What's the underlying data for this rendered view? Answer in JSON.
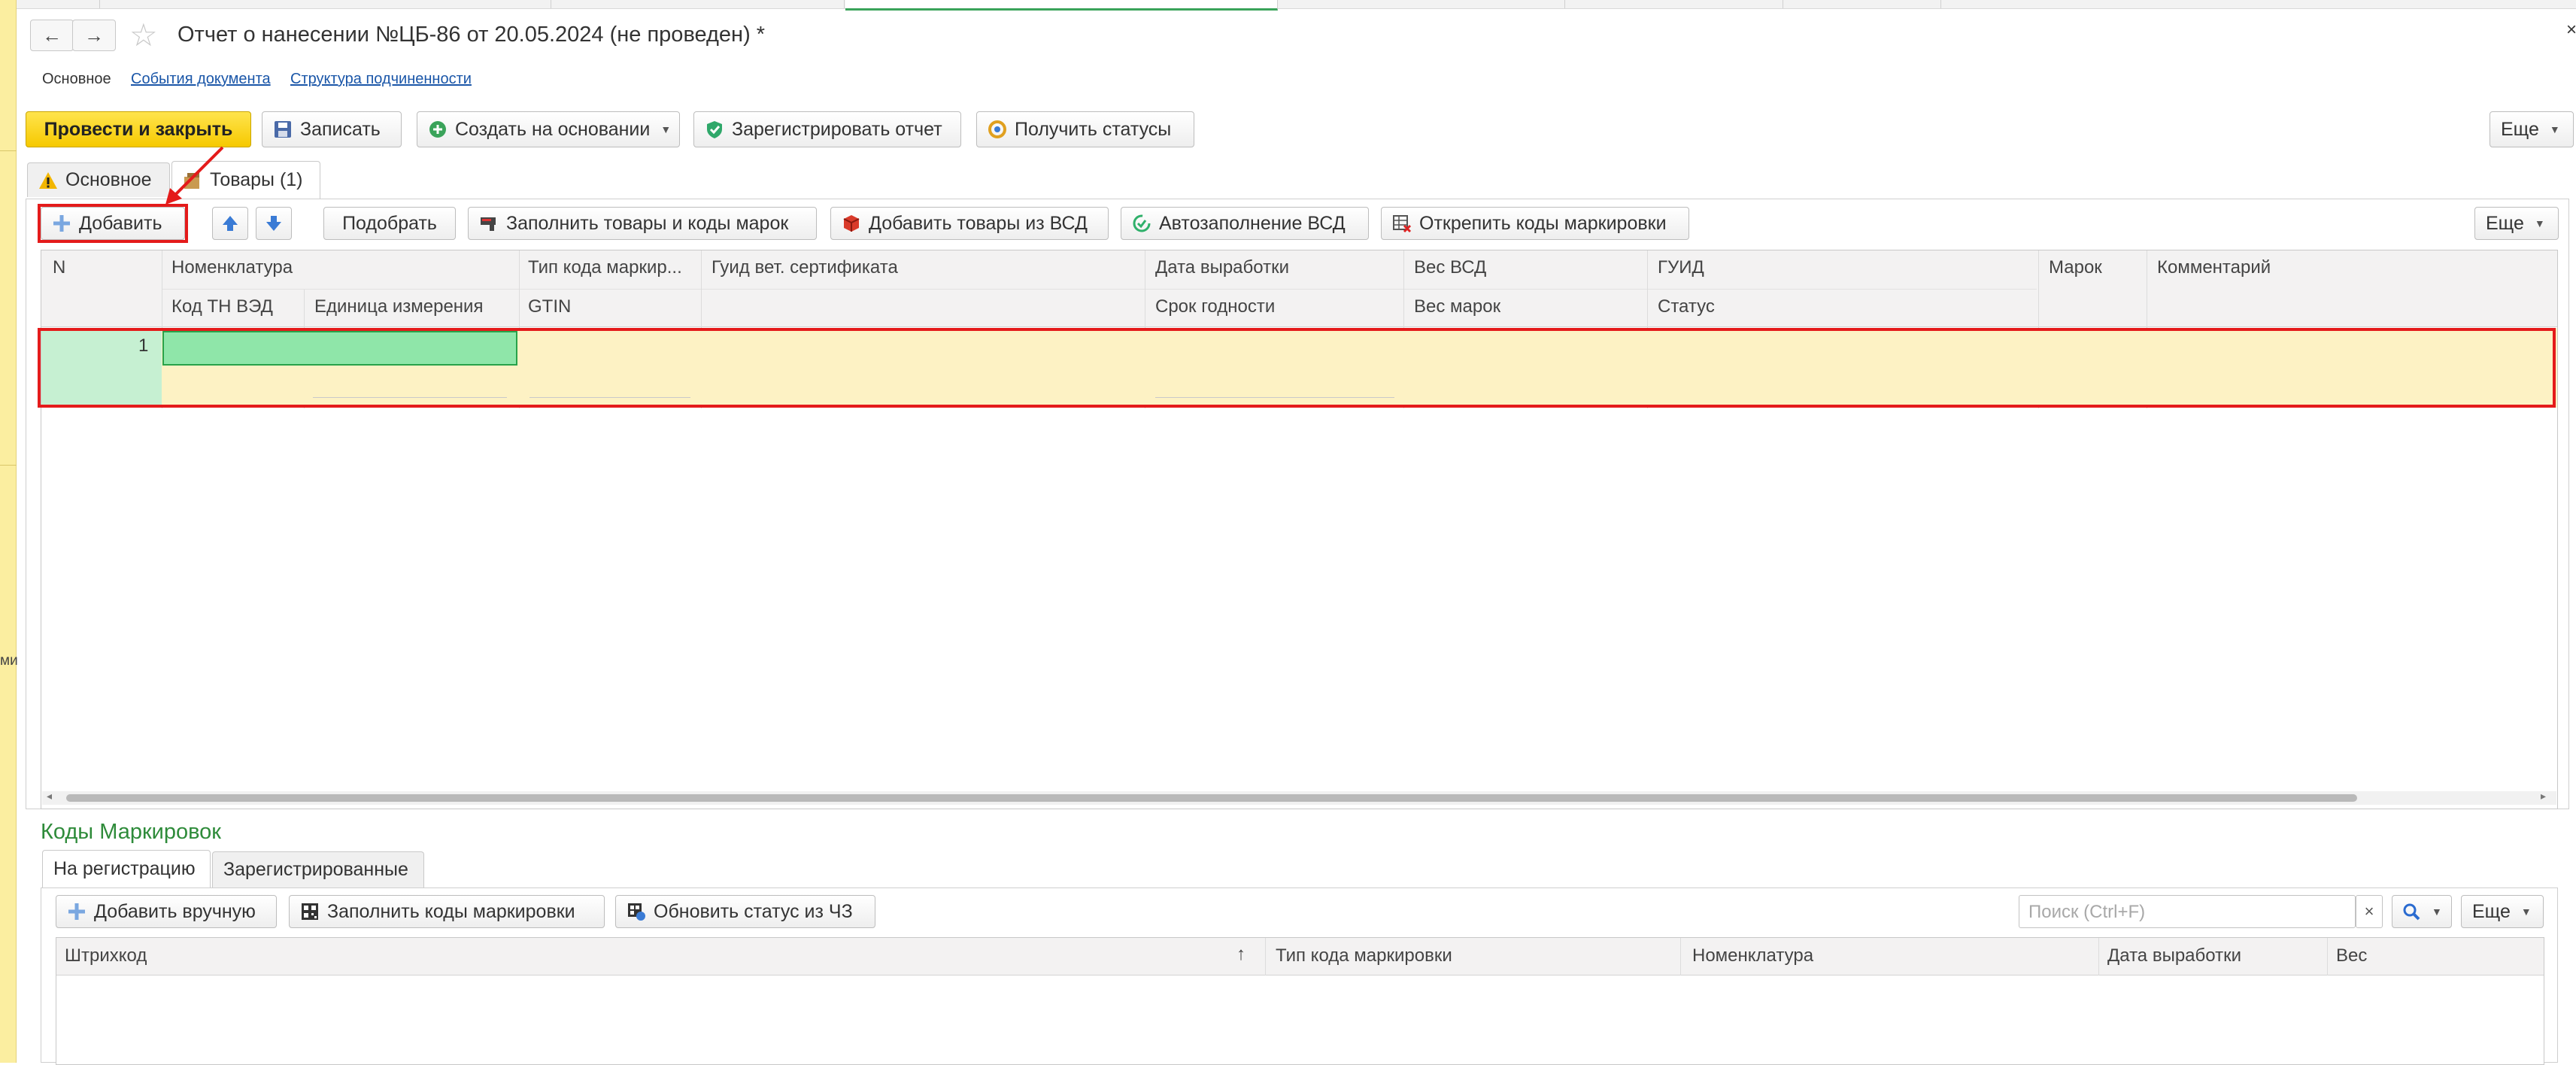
{
  "left_strip": {
    "text": "ми"
  },
  "header": {
    "title": "Отчет о нанесении №ЦБ-86 от 20.05.2024 (не проведен) *",
    "subnav": [
      "Основное",
      "События документа",
      "Структура подчиненности"
    ]
  },
  "toolbar": {
    "post_close": "Провести и закрыть",
    "save": "Записать",
    "create_based": "Создать на основании",
    "register_report": "Зарегистрировать отчет",
    "get_statuses": "Получить статусы",
    "more": "Еще"
  },
  "tabs": [
    {
      "label": "Основное",
      "icon": "warning-icon"
    },
    {
      "label": "Товары (1)",
      "icon": "goods-icon"
    }
  ],
  "goods_toolbar": {
    "add": "Добавить",
    "pick": "Подобрать",
    "fill_goods_codes": "Заполнить товары и коды марок",
    "add_from_vsd": "Добавить товары из ВСД",
    "autofill_vsd": "Автозаполнение ВСД",
    "unpin_codes": "Открепить коды маркировки",
    "more": "Еще"
  },
  "goods_table": {
    "columns_row1": [
      "N",
      "Номенклатура",
      "Тип кода маркир...",
      "Гуид вет. сертификата",
      "Дата выработки",
      "Вес ВСД",
      "ГУИД",
      "Марок",
      "Комментарий"
    ],
    "columns_row2": [
      "Код ТН ВЭД",
      "Единица измерения",
      "GTIN",
      "Срок годности",
      "Вес марок",
      "Статус"
    ],
    "rows": [
      {
        "n": "1"
      }
    ]
  },
  "marking": {
    "title": "Коды Маркировок",
    "tabs": [
      "На регистрацию",
      "Зарегистрированные"
    ],
    "add_manual": "Добавить вручную",
    "fill_codes": "Заполнить коды маркировки",
    "update_status": "Обновить статус из ЧЗ",
    "search_placeholder": "Поиск (Ctrl+F)",
    "search_clear": "×",
    "more": "Еще",
    "columns": [
      "Штрихкод",
      "Тип кода маркировки",
      "Номенклатура",
      "Дата выработки",
      "Вес"
    ],
    "sort_indicator": "↑"
  },
  "colors": {
    "accent_yellow": "#f6c900",
    "highlight_red": "#e41b1b",
    "section_green": "#2e8b3a",
    "row_yellow": "#fdf2c4"
  }
}
